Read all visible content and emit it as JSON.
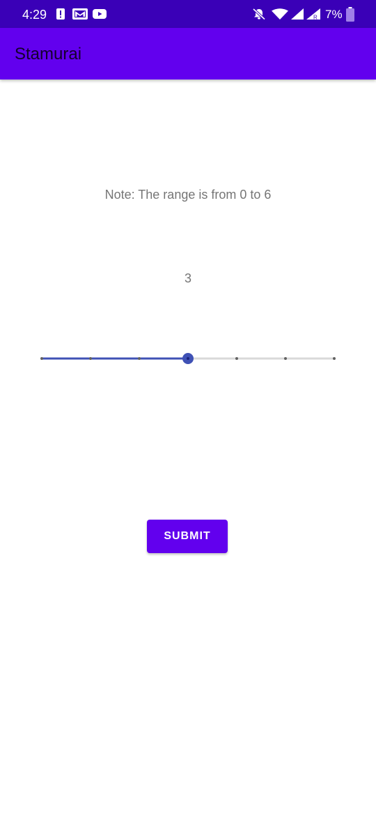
{
  "status_bar": {
    "time": "4:29",
    "battery_percent": "7%",
    "icons": [
      "alert-icon",
      "gmail-icon",
      "youtube-icon",
      "notifications-off-icon",
      "wifi-icon",
      "signal-icon",
      "signal-roaming-icon",
      "battery-icon"
    ]
  },
  "app_bar": {
    "title": "Stamurai"
  },
  "content": {
    "note": "Note: The range is from 0 to 6",
    "current_value_label": "3",
    "slider": {
      "min": 0,
      "max": 6,
      "value": 3
    }
  },
  "actions": {
    "submit_label": "SUBMIT"
  },
  "colors": {
    "status_bar": "#3a00b7",
    "app_bar": "#6200ee",
    "slider_active": "#3f51b5",
    "slider_inactive": "#d9d9d9",
    "tick": "#616161"
  }
}
